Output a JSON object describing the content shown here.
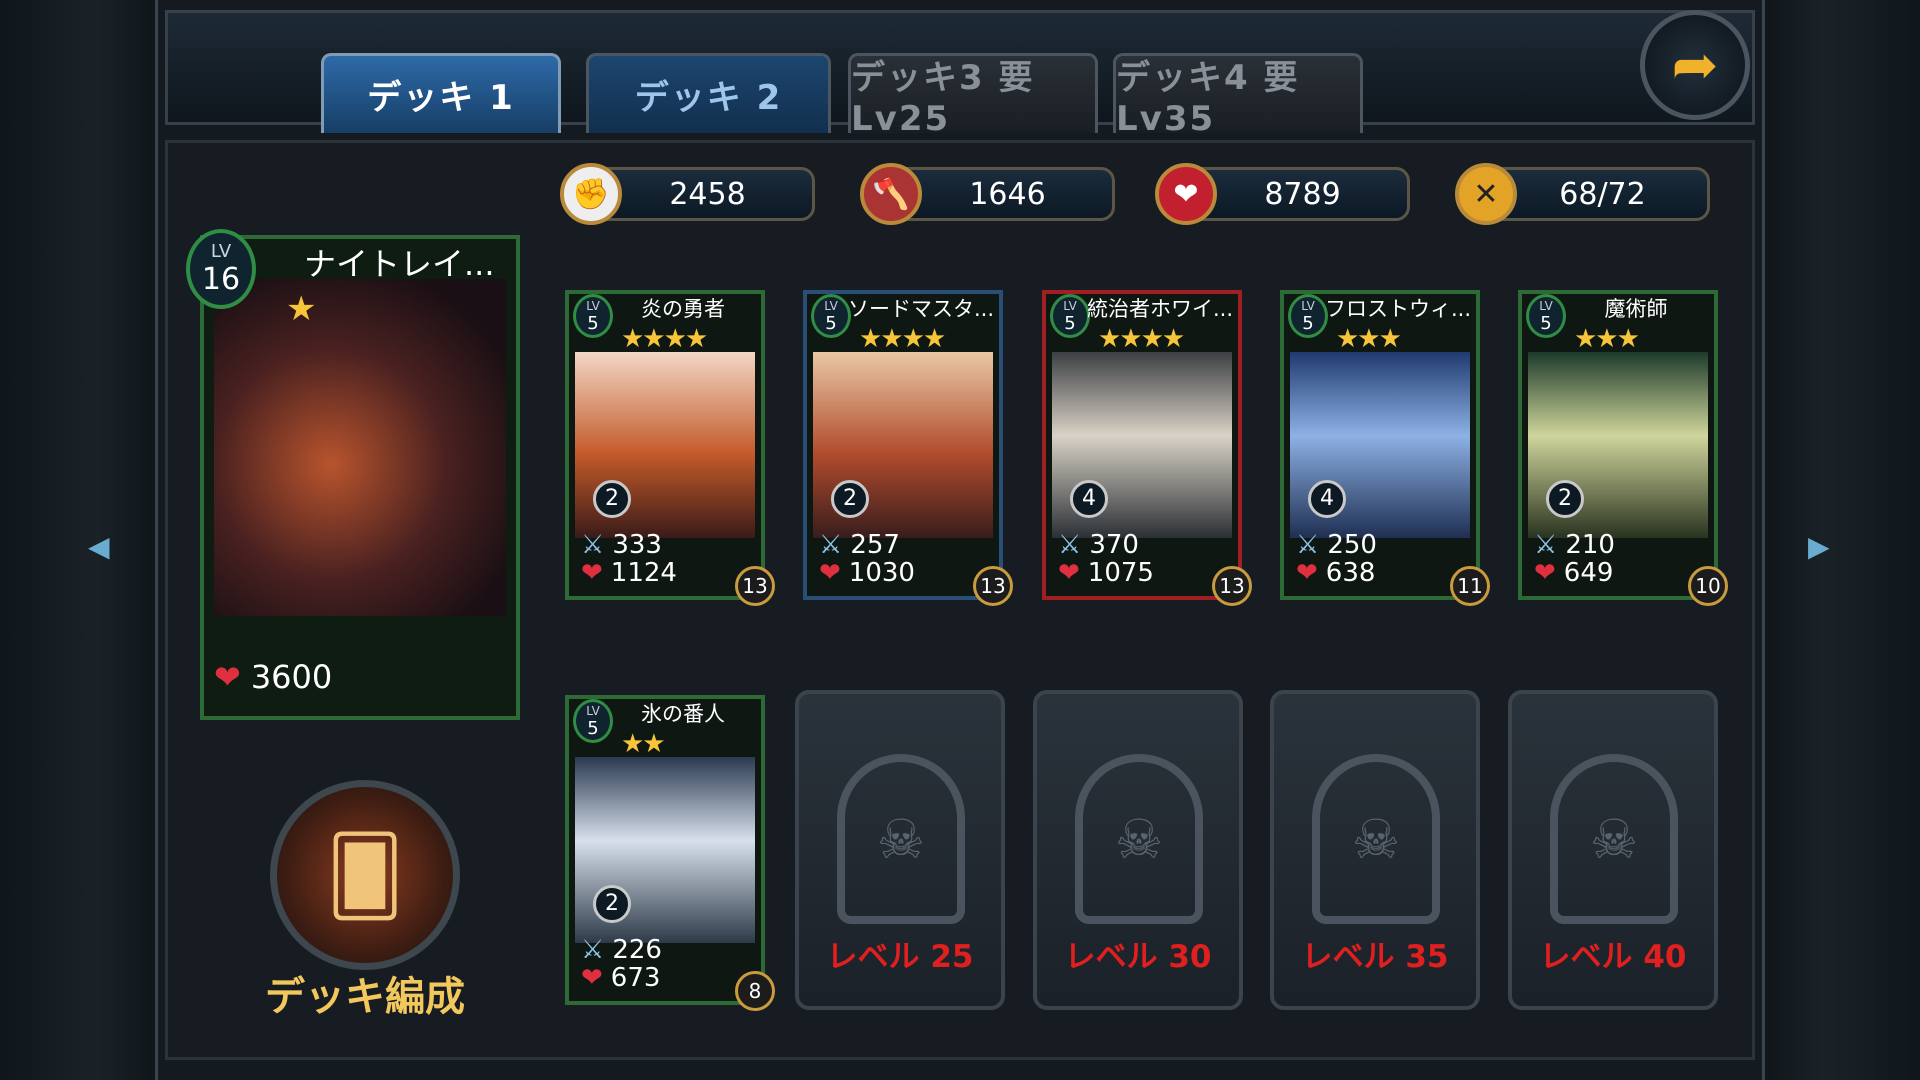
{
  "tabs": [
    {
      "label": "デッキ 1",
      "state": "active"
    },
    {
      "label": "デッキ 2",
      "state": "normal"
    },
    {
      "label": "デッキ3 要Lv25",
      "state": "locked"
    },
    {
      "label": "デッキ4 要Lv35",
      "state": "locked"
    }
  ],
  "stats": [
    {
      "icon": "fist-icon",
      "value": "2458"
    },
    {
      "icon": "axe-icon",
      "value": "1646"
    },
    {
      "icon": "heart-icon",
      "value": "8789"
    },
    {
      "icon": "swords-icon",
      "value": "68/72"
    }
  ],
  "leader": {
    "lv_label": "LV",
    "lv": "16",
    "name": "ナイトレイ...",
    "stars": "★",
    "hp": "3600"
  },
  "cards": [
    {
      "lv": "5",
      "name": "炎の勇者",
      "stars": "★★★★",
      "cost": "2",
      "atk": "333",
      "hp": "1124",
      "rank": "13",
      "border": "#2d6a36",
      "art": "linear-gradient(#f2d7c5,#c35a2a 55%,#3a1b18)"
    },
    {
      "lv": "5",
      "name": "ソードマスタ...",
      "stars": "★★★★",
      "cost": "2",
      "atk": "257",
      "hp": "1030",
      "rank": "13",
      "border": "#2a4f76",
      "art": "linear-gradient(#e9c8a4,#b14b2d 55%,#381d1c)"
    },
    {
      "lv": "5",
      "name": "統治者ホワイ...",
      "stars": "★★★★",
      "cost": "4",
      "atk": "370",
      "hp": "1075",
      "rank": "13",
      "border": "#a01f23",
      "art": "linear-gradient(#3c3f43,#d9d2c6 45%,#2b3035)"
    },
    {
      "lv": "5",
      "name": "フロストウィ...",
      "stars": "★★★",
      "cost": "4",
      "atk": "250",
      "hp": "638",
      "rank": "11",
      "border": "#2d6a36",
      "art": "linear-gradient(#203a6f,#8db1e5 45%,#1f2f52)"
    },
    {
      "lv": "5",
      "name": "魔術師",
      "stars": "★★★",
      "cost": "2",
      "atk": "210",
      "hp": "649",
      "rank": "10",
      "border": "#2d6a36",
      "art": "linear-gradient(#1d3a2a,#cfd59b 45%,#2a3320)"
    },
    {
      "lv": "5",
      "name": "氷の番人",
      "stars": "★★",
      "cost": "2",
      "atk": "226",
      "hp": "673",
      "rank": "8",
      "border": "#2d6a36",
      "art": "linear-gradient(#2a3a50,#d7e0ec 45%,#2d3a48)"
    }
  ],
  "locked_slots": [
    "レベル 25",
    "レベル 30",
    "レベル 35",
    "レベル 40"
  ],
  "deck_button_label": "デッキ編成"
}
